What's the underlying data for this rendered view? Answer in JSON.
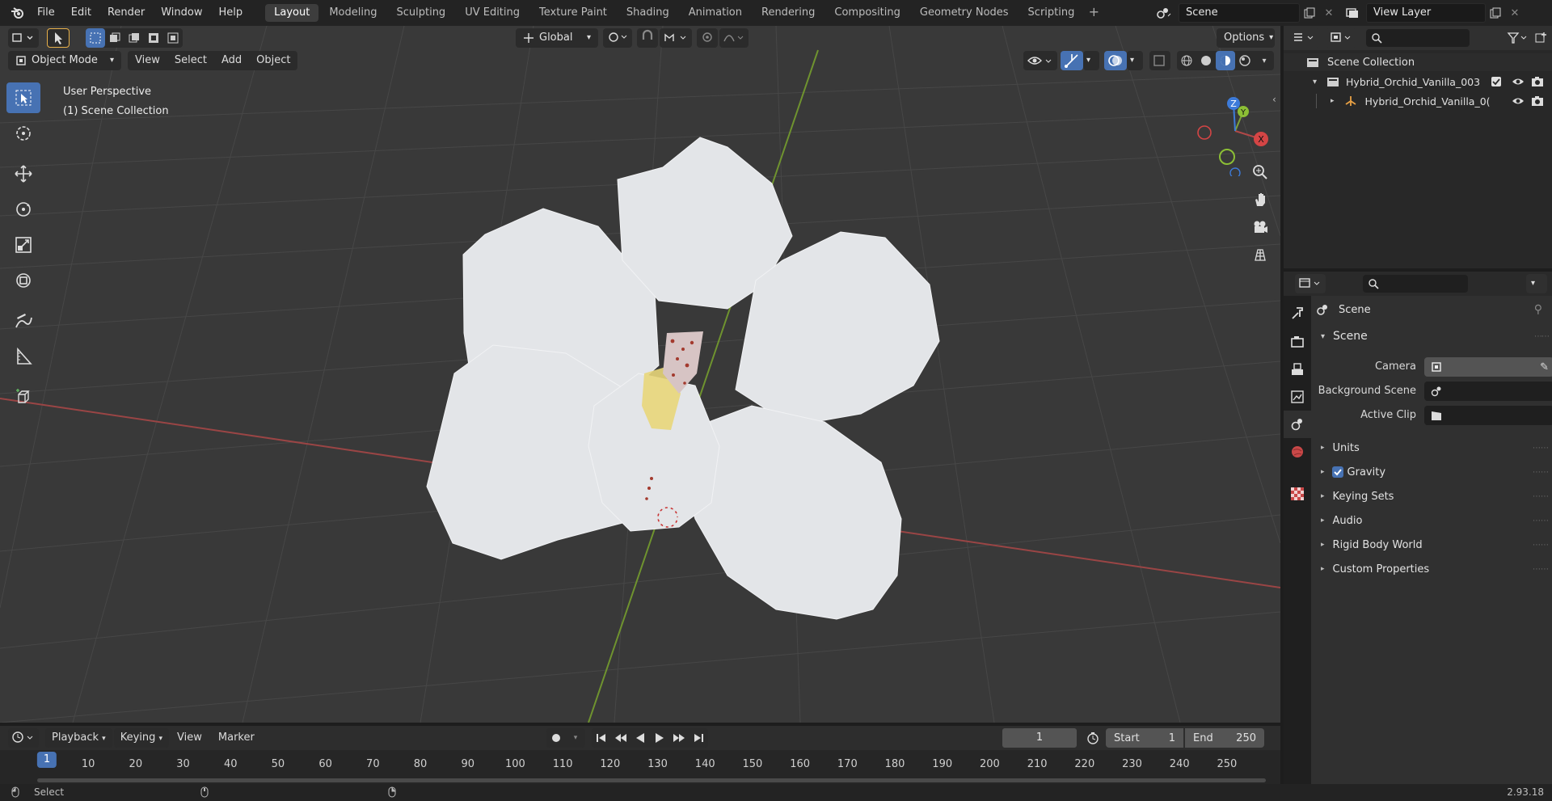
{
  "topbar": {
    "menus": [
      "File",
      "Edit",
      "Render",
      "Window",
      "Help"
    ],
    "workspaces": [
      "Layout",
      "Modeling",
      "Sculpting",
      "UV Editing",
      "Texture Paint",
      "Shading",
      "Animation",
      "Rendering",
      "Compositing",
      "Geometry Nodes",
      "Scripting"
    ],
    "active_workspace": "Layout",
    "scene_name": "Scene",
    "view_layer": "View Layer"
  },
  "viewport": {
    "orientation": "Global",
    "options_label": "Options",
    "mode": "Object Mode",
    "menus": [
      "View",
      "Select",
      "Add",
      "Object"
    ],
    "perspective_label": "User Perspective",
    "collection_label": "(1) Scene Collection",
    "gizmo_axes": {
      "x": "X",
      "y": "Y",
      "z": "Z"
    }
  },
  "outliner": {
    "root": "Scene Collection",
    "items": [
      {
        "label": "Hybrid_Orchid_Vanilla_003"
      },
      {
        "label": "Hybrid_Orchid_Vanilla_0("
      }
    ]
  },
  "properties": {
    "context": "Scene",
    "section": "Scene",
    "fields": [
      {
        "label": "Camera"
      },
      {
        "label": "Background Scene"
      },
      {
        "label": "Active Clip"
      }
    ],
    "subpanels": [
      "Units",
      "Gravity",
      "Keying Sets",
      "Audio",
      "Rigid Body World",
      "Custom Properties"
    ],
    "gravity_checked": true
  },
  "timeline": {
    "menus": [
      "Playback",
      "Keying",
      "View",
      "Marker"
    ],
    "current_frame": "1",
    "start_label": "Start",
    "start_value": "1",
    "end_label": "End",
    "end_value": "250",
    "ticks": [
      "1",
      "10",
      "20",
      "30",
      "40",
      "50",
      "60",
      "70",
      "80",
      "90",
      "100",
      "110",
      "120",
      "130",
      "140",
      "150",
      "160",
      "170",
      "180",
      "190",
      "200",
      "210",
      "220",
      "230",
      "240",
      "250"
    ]
  },
  "status": {
    "left_label": "Select",
    "version": "2.93.18"
  },
  "colors": {
    "accent": "#4772b3",
    "x_axis": "#b04848",
    "y_axis": "#7ea33a",
    "z_axis": "#3d7bd9"
  }
}
